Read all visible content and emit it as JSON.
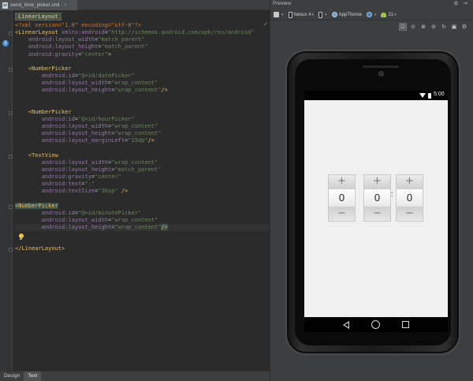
{
  "editor": {
    "file_tab": "send_time_picker.xml",
    "close_glyph": "×",
    "breadcrumb": "LinearLayout",
    "code_lines": [
      [
        [
          "dec",
          "<?xml version=\"1.0\" encoding=\"utf-8\"?>"
        ]
      ],
      [
        [
          "tag",
          "<LinearLayout "
        ],
        [
          "attr",
          "xmlns:"
        ],
        [
          "attr",
          "android"
        ],
        [
          "plain",
          "="
        ],
        [
          "val",
          "\"http://schemas.android.com/apk/res/android\""
        ]
      ],
      [
        [
          "plain",
          "    "
        ],
        [
          "attr",
          "android:layout_width"
        ],
        [
          "plain",
          "="
        ],
        [
          "val",
          "\"match_parent\""
        ]
      ],
      [
        [
          "plain",
          "    "
        ],
        [
          "attr",
          "android:layout_height"
        ],
        [
          "plain",
          "="
        ],
        [
          "val",
          "\"match_parent\""
        ]
      ],
      [
        [
          "plain",
          "    "
        ],
        [
          "attr",
          "android:gravity"
        ],
        [
          "plain",
          "="
        ],
        [
          "val",
          "\"center\""
        ],
        [
          "tag",
          ">"
        ]
      ],
      [
        [
          "plain",
          ""
        ]
      ],
      [
        [
          "plain",
          "    "
        ],
        [
          "tag",
          "<NumberPicker"
        ]
      ],
      [
        [
          "plain",
          "        "
        ],
        [
          "attr",
          "android:id"
        ],
        [
          "plain",
          "="
        ],
        [
          "val",
          "\"@+id/datePicker\""
        ]
      ],
      [
        [
          "plain",
          "        "
        ],
        [
          "attr",
          "android:layout_width"
        ],
        [
          "plain",
          "="
        ],
        [
          "val",
          "\"wrap_content\""
        ]
      ],
      [
        [
          "plain",
          "        "
        ],
        [
          "attr",
          "android:layout_height"
        ],
        [
          "plain",
          "="
        ],
        [
          "val",
          "\"wrap_content\""
        ],
        [
          "tag",
          "/>"
        ]
      ],
      [
        [
          "plain",
          ""
        ]
      ],
      [
        [
          "plain",
          ""
        ]
      ],
      [
        [
          "plain",
          "    "
        ],
        [
          "tag",
          "<NumberPicker"
        ]
      ],
      [
        [
          "plain",
          "        "
        ],
        [
          "attr",
          "android:id"
        ],
        [
          "plain",
          "="
        ],
        [
          "val",
          "\"@+id/hourPicker\""
        ]
      ],
      [
        [
          "plain",
          "        "
        ],
        [
          "attr",
          "android:layout_width"
        ],
        [
          "plain",
          "="
        ],
        [
          "val",
          "\"wrap_content\""
        ]
      ],
      [
        [
          "plain",
          "        "
        ],
        [
          "attr",
          "android:layout_height"
        ],
        [
          "plain",
          "="
        ],
        [
          "val",
          "\"wrap_content\""
        ]
      ],
      [
        [
          "plain",
          "        "
        ],
        [
          "attr",
          "android:layout_marginLeft"
        ],
        [
          "plain",
          "="
        ],
        [
          "val",
          "\"15dp\""
        ],
        [
          "tag",
          "/>"
        ]
      ],
      [
        [
          "plain",
          ""
        ]
      ],
      [
        [
          "plain",
          "    "
        ],
        [
          "tag",
          "<TextView"
        ]
      ],
      [
        [
          "plain",
          "        "
        ],
        [
          "attr",
          "android:layout_width"
        ],
        [
          "plain",
          "="
        ],
        [
          "val",
          "\"wrap_content\""
        ]
      ],
      [
        [
          "plain",
          "        "
        ],
        [
          "attr",
          "android:layout_height"
        ],
        [
          "plain",
          "="
        ],
        [
          "val",
          "\"match_parent\""
        ]
      ],
      [
        [
          "plain",
          "        "
        ],
        [
          "attr",
          "android:gravity"
        ],
        [
          "plain",
          "="
        ],
        [
          "val",
          "\"center\""
        ]
      ],
      [
        [
          "plain",
          "        "
        ],
        [
          "attr",
          "android:text"
        ],
        [
          "plain",
          "="
        ],
        [
          "val",
          "\":\""
        ]
      ],
      [
        [
          "plain",
          "        "
        ],
        [
          "attr",
          "android:textSize"
        ],
        [
          "plain",
          "="
        ],
        [
          "val",
          "\"30sp\""
        ],
        [
          "tag",
          " />"
        ]
      ],
      [
        [
          "plain",
          ""
        ]
      ],
      [
        [
          "hltag",
          "<NumberPicker"
        ]
      ],
      [
        [
          "plain",
          "        "
        ],
        [
          "attr",
          "android:id"
        ],
        [
          "plain",
          "="
        ],
        [
          "val",
          "\"@+id/minutePicker\""
        ]
      ],
      [
        [
          "plain",
          "        "
        ],
        [
          "attr",
          "android:layout_width"
        ],
        [
          "plain",
          "="
        ],
        [
          "val",
          "\"wrap_content\""
        ]
      ],
      [
        [
          "plain",
          "        "
        ],
        [
          "attr",
          "android:layout_height"
        ],
        [
          "plain",
          "="
        ],
        [
          "val",
          "\"wrap_content\""
        ],
        [
          "hltag",
          "/>"
        ]
      ],
      [
        [
          "plain",
          ""
        ]
      ],
      [
        [
          "plain",
          ""
        ]
      ],
      [
        [
          "tag",
          "</LinearLayout>"
        ]
      ]
    ],
    "current_line": 28,
    "bottom_tabs": [
      {
        "label": "Design",
        "active": false
      },
      {
        "label": "Text",
        "active": true
      }
    ]
  },
  "preview": {
    "title": "Preview",
    "toolbar": {
      "device": "Nexus 4",
      "theme": "AppTheme",
      "api": "21"
    },
    "zoom_buttons": [
      "zoom-fit",
      "zoom-actual",
      "zoom-in",
      "zoom-out",
      "refresh",
      "screenshot",
      "settings"
    ],
    "phone": {
      "clock": "5:00",
      "pickers": [
        {
          "plus": "+",
          "value": "0",
          "minus": "−"
        },
        {
          "plus": "+",
          "value": "0",
          "minus": "−"
        },
        {
          "plus": "+",
          "value": "0",
          "minus": "−"
        }
      ],
      "separator": ":"
    }
  }
}
